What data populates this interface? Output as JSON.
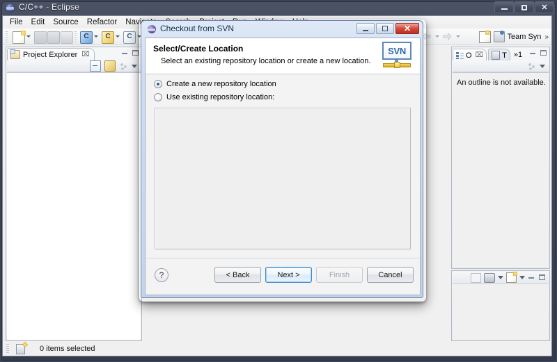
{
  "window": {
    "title": "C/C++ - Eclipse",
    "icon": "eclipse-icon",
    "minimize": "–",
    "maximize": "□",
    "close": "✕"
  },
  "menubar": {
    "items": [
      {
        "label": "File"
      },
      {
        "label": "Edit"
      },
      {
        "label": "Source"
      },
      {
        "label": "Refactor"
      },
      {
        "label": "Navigate"
      },
      {
        "label": "Search"
      },
      {
        "label": "Project"
      },
      {
        "label": "Run"
      },
      {
        "label": "Window"
      },
      {
        "label": "Help"
      }
    ]
  },
  "toolbar": {
    "icons": [
      "new-document-icon",
      "save-icon",
      "save-all-icon",
      "print-icon",
      "new-c-project-icon",
      "new-cpp-project-icon",
      "new-c-file-icon",
      "back-arrow-icon",
      "forward-arrow-icon"
    ],
    "c_glyph": "C",
    "cpp_glyph": "C"
  },
  "perspective_bar": {
    "open_perspective_icon": "open-perspective-icon",
    "team_sync_icon": "team-synchronizing-icon",
    "team_sync_label": "Team Syn",
    "overflow": "»"
  },
  "project_explorer": {
    "tab_label": "Project Explorer",
    "tab_close": "⌧",
    "toolbar_icons": [
      "collapse-all-icon",
      "link-with-editor-icon",
      "view-menu-dots-icon",
      "view-menu-caret-icon"
    ]
  },
  "outline_view": {
    "tab_label": "O",
    "tab_close": "⌧",
    "tasklist_tab_label": "T",
    "overflow_label": "»1",
    "message": "An outline is not available."
  },
  "lower_right_view": {
    "toolbar_icons": [
      "open-external-icon",
      "monitor-icon",
      "monitor-menu-caret-icon",
      "new-icon",
      "new-menu-caret-icon"
    ]
  },
  "statusbar": {
    "icon": "selection-icon",
    "text": "0 items selected"
  },
  "dialog": {
    "title": "Checkout from SVN",
    "icon": "eclipse-dialog-icon",
    "minimize": "–",
    "maximize": "□",
    "close": "✕",
    "header": {
      "title": "Select/Create Location",
      "description": "Select an existing repository location or create a new location.",
      "logo_text": "SVN",
      "logo_name": "svn-logo"
    },
    "options": [
      {
        "label": "Create a new repository location",
        "selected": true
      },
      {
        "label": "Use existing repository location:",
        "selected": false
      }
    ],
    "repository_list": {
      "items": [],
      "enabled": false
    },
    "buttons": {
      "help": "?",
      "back": "< Back",
      "next": "Next >",
      "finish": "Finish",
      "cancel": "Cancel"
    }
  },
  "colors": {
    "accent": "#3c8bd0",
    "dialog_title_bg": "#cfddf0",
    "svn_blue": "#2f6ba8",
    "svn_gold": "#d9a81c",
    "close_red": "#d44a3c"
  }
}
